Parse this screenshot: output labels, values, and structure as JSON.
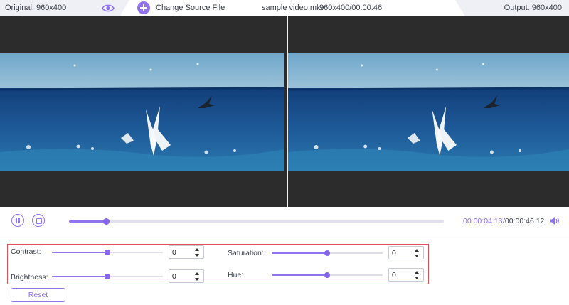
{
  "topbar": {
    "original_label": "Original: 960x400",
    "change_source_label": "Change Source File",
    "file_name": "sample video.mkv",
    "resolution_duration": "960x400/00:00:46",
    "output_label": "Output: 960x400",
    "icons": {
      "preview_toggle": "eye-icon",
      "add": "plus-icon"
    }
  },
  "player": {
    "current_time": "00:00:04.13",
    "total_time": "/00:00:46.12",
    "progress_fraction": 0.1,
    "icons": {
      "pause": "pause-icon",
      "stop": "stop-icon",
      "volume": "volume-icon"
    }
  },
  "adjustments": {
    "contrast": {
      "label": "Contrast:",
      "value": "0",
      "level": 0.5
    },
    "brightness": {
      "label": "Brightness:",
      "value": "0",
      "level": 0.5
    },
    "saturation": {
      "label": "Saturation:",
      "value": "0",
      "level": 0.5
    },
    "hue": {
      "label": "Hue:",
      "value": "0",
      "level": 0.5
    }
  },
  "reset_label": "Reset",
  "colors": {
    "accent": "#9173f0",
    "highlight_border": "#e2525c",
    "preview_bg": "#2c2c2c"
  }
}
